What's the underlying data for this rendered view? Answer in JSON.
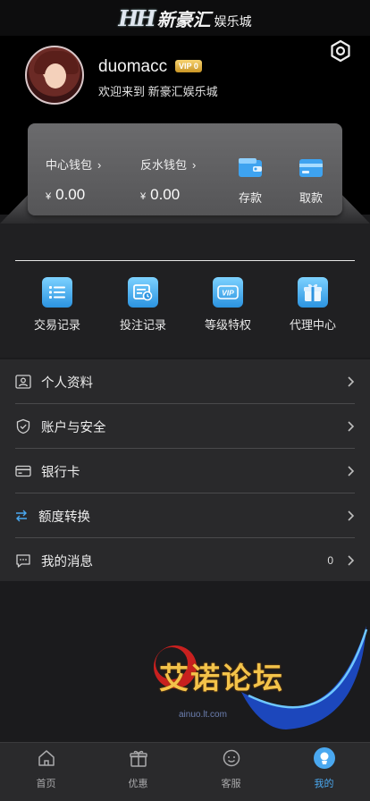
{
  "header": {
    "logo_mark": "HH",
    "logo_name": "新豪汇",
    "logo_suffix": "娱乐城"
  },
  "profile": {
    "username": "duomacc",
    "vip_badge": "VIP 0",
    "welcome": "欢迎来到 新豪汇娱乐城",
    "avatar_icon": "avatar",
    "settings_icon": "gear-icon"
  },
  "wallet": {
    "center_label": "中心钱包",
    "center_amount": "0.00",
    "rebate_label": "反水钱包",
    "rebate_amount": "0.00",
    "currency": "¥",
    "deposit_label": "存款",
    "withdraw_label": "取款"
  },
  "quick_links": [
    {
      "label": "交易记录",
      "icon": "list-icon"
    },
    {
      "label": "投注记录",
      "icon": "bet-record-icon"
    },
    {
      "label": "等级特权",
      "icon": "vip-icon"
    },
    {
      "label": "代理中心",
      "icon": "gift-icon"
    }
  ],
  "menu": [
    {
      "label": "个人资料",
      "icon": "id-card-icon"
    },
    {
      "label": "账户与安全",
      "icon": "shield-icon"
    },
    {
      "label": "银行卡",
      "icon": "card-icon"
    },
    {
      "label": "额度转换",
      "icon": "transfer-icon"
    },
    {
      "label": "我的消息",
      "icon": "message-icon",
      "count": "0"
    }
  ],
  "watermark": {
    "text": "艾诺论坛",
    "url": "ainuo.lt.com"
  },
  "tabs": [
    {
      "label": "首页",
      "icon": "home-icon"
    },
    {
      "label": "优惠",
      "icon": "gift-icon"
    },
    {
      "label": "客服",
      "icon": "support-icon"
    },
    {
      "label": "我的",
      "icon": "profile-icon",
      "active": true
    }
  ],
  "colors": {
    "accent": "#4aa8f0",
    "vip_gold": "#e0b040",
    "background": "#1b1b1d"
  }
}
